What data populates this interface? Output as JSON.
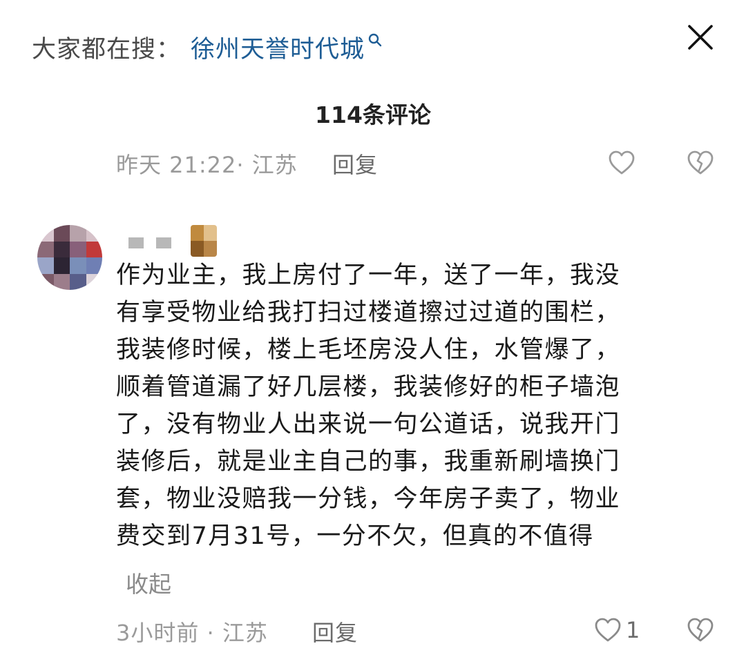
{
  "search_bar": {
    "prefix": "大家都在搜：",
    "term": "徐州天誉时代城",
    "icon": "search-icon"
  },
  "close_icon": "close-icon",
  "header": {
    "comment_count": "114条评论"
  },
  "prev_comment": {
    "time_location": "昨天 21:22· 江苏",
    "reply_label": "回复"
  },
  "comment": {
    "lines": [
      "作为业主，我上房付了一年，送了一年，我没",
      "有享受物业给我打扫过楼道擦过过道的围栏，",
      "我装修时候，楼上毛坯房没人住，水管爆了，",
      "顺着管道漏了好几层楼，我装修好的柜子墙泡",
      "了，没有物业人出来说一句公道话，说我开门",
      "装修后，就是业主自己的事，我重新刷墙换门",
      "套，物业没赔我一分钱，今年房子卖了，物业",
      "费交到7月31号，一分不欠，但真的不值得"
    ],
    "collapse_label": "收起",
    "time_location": "3小时前 · 江苏",
    "reply_label": "回复",
    "like_count": "1"
  },
  "colors": {
    "link_blue": "#1e5d95",
    "meta_gray": "#9a9a9a",
    "text_dark": "#1a1a1a"
  }
}
